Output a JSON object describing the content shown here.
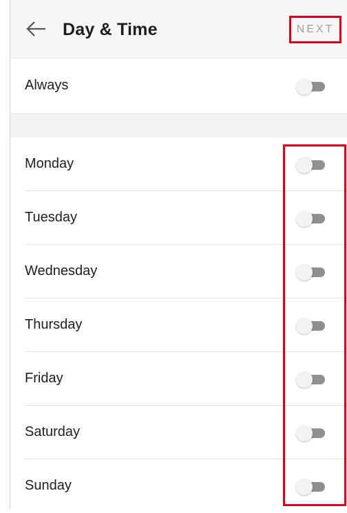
{
  "app_bar": {
    "title": "Day & Time",
    "back_icon": "arrow-left-icon",
    "next_label": "NEXT"
  },
  "always": {
    "label": "Always",
    "enabled": false
  },
  "days": [
    {
      "label": "Monday",
      "enabled": false
    },
    {
      "label": "Tuesday",
      "enabled": false
    },
    {
      "label": "Wednesday",
      "enabled": false
    },
    {
      "label": "Thursday",
      "enabled": false
    },
    {
      "label": "Friday",
      "enabled": false
    },
    {
      "label": "Saturday",
      "enabled": false
    },
    {
      "label": "Sunday",
      "enabled": false
    }
  ],
  "colors": {
    "highlight_red": "#e0001b",
    "toggle_track": "#8f8f8f",
    "toggle_thumb": "#f3f3f3"
  }
}
